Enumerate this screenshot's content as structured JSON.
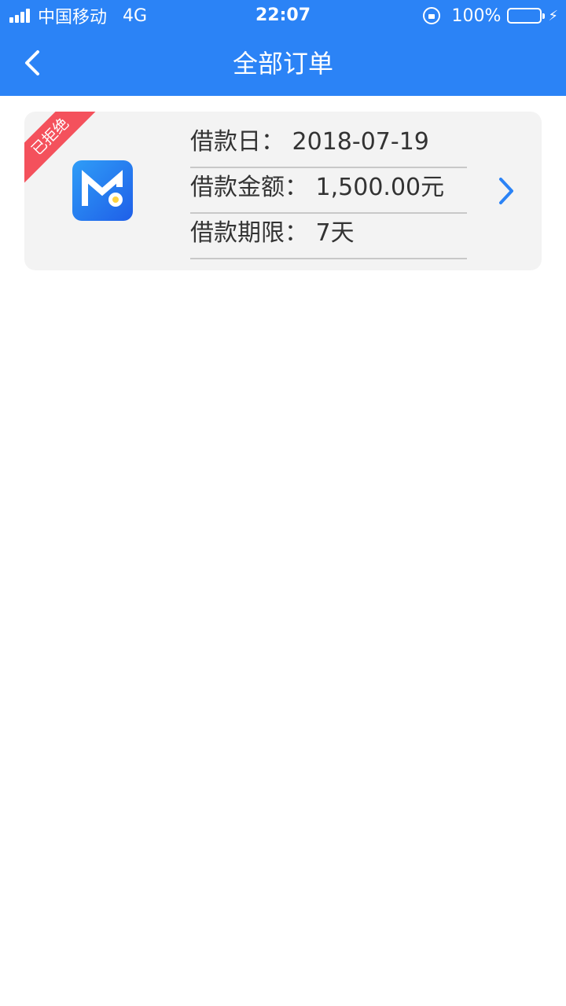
{
  "status_bar": {
    "carrier": "中国移动",
    "network": "4G",
    "time": "22:07",
    "battery": "100%",
    "battery_color": "#4cd964"
  },
  "nav": {
    "title": "全部订单",
    "back_icon": "chevron-left-icon"
  },
  "orders": [
    {
      "status_badge": "已拒绝",
      "status_color": "#f4515c",
      "icon": "app-logo-icon",
      "loan_date": "借款日：  2018-07-19",
      "loan_amount": "借款金额：  1,500.00元",
      "loan_term": "借款期限：  7天",
      "detail_icon": "chevron-right-icon"
    }
  ],
  "colors": {
    "accent": "#2b83f6",
    "card_bg": "#f3f3f3"
  }
}
